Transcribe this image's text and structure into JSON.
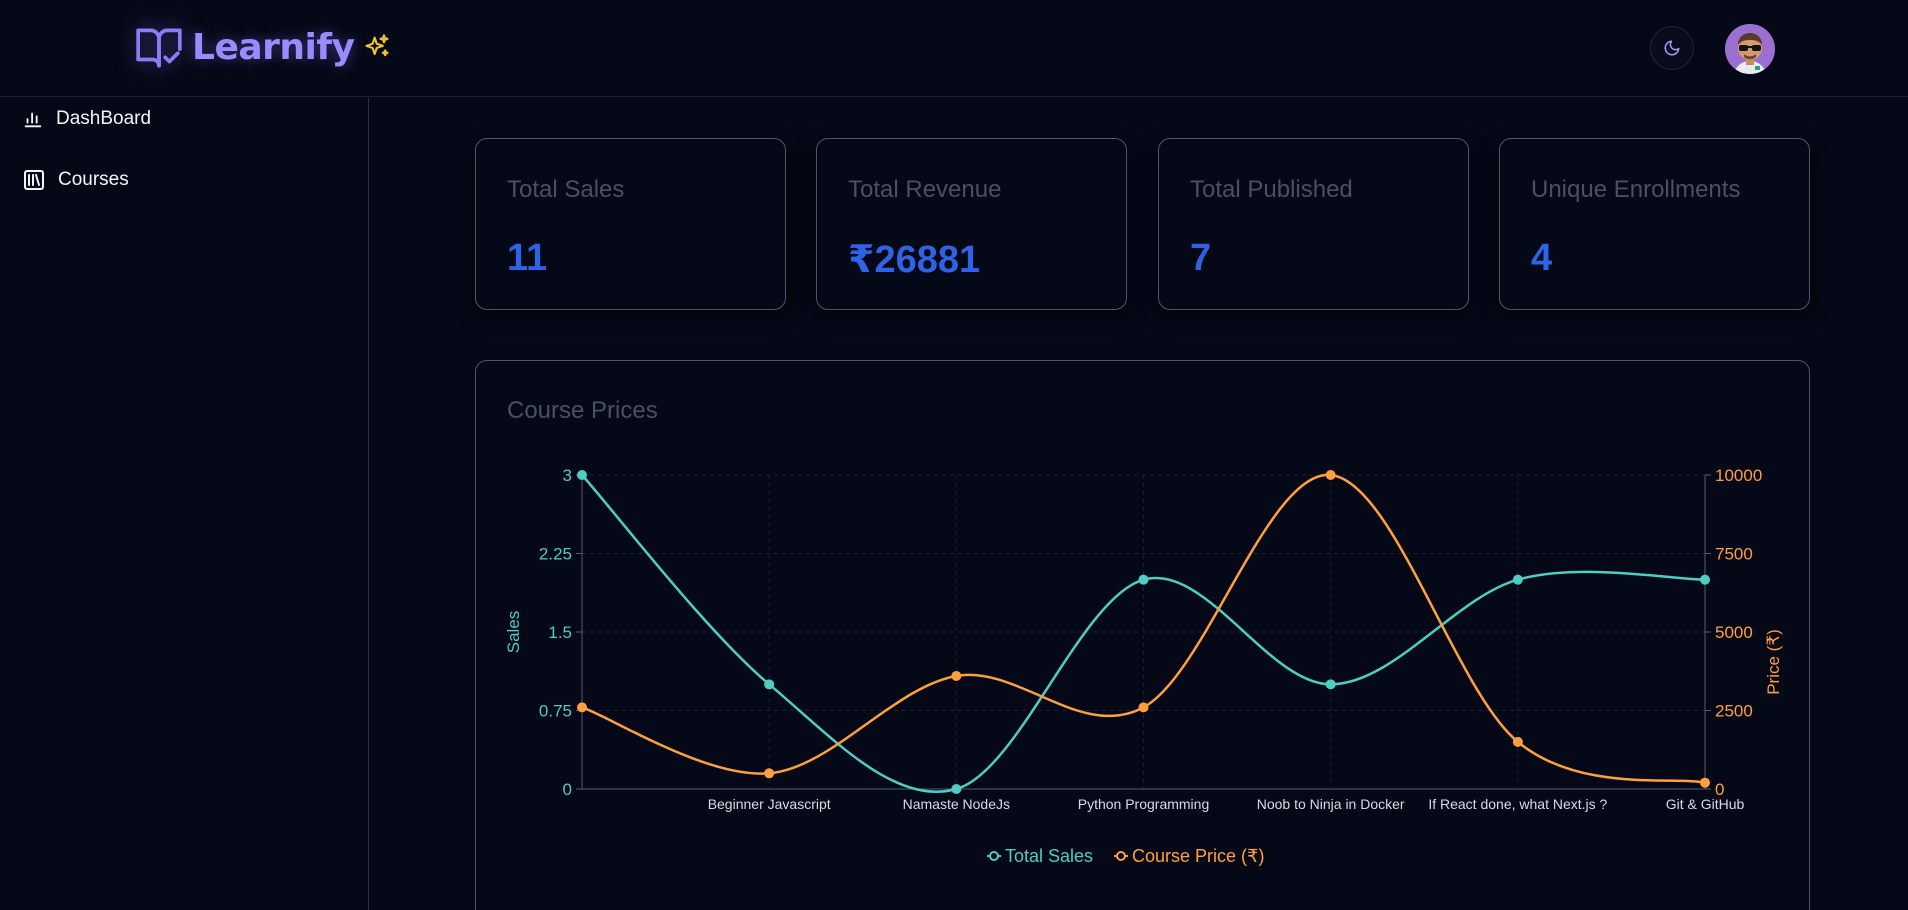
{
  "app": {
    "name": "Learnify"
  },
  "header": {
    "logo_icon": "book-check-icon",
    "sparkle_icon": "sparkles-icon",
    "theme_icon": "moon-icon",
    "avatar_icon": "avatar-memoji"
  },
  "sidebar": {
    "items": [
      {
        "label": "DashBoard",
        "icon": "bar-chart-icon"
      },
      {
        "label": "Courses",
        "icon": "library-icon"
      }
    ]
  },
  "stats": [
    {
      "title": "Total Sales",
      "value": "11"
    },
    {
      "title": "Total Revenue",
      "value": "₹26881"
    },
    {
      "title": "Total Published",
      "value": "7"
    },
    {
      "title": "Unique Enrollments",
      "value": "4"
    }
  ],
  "colors": {
    "accent": "#9a8cff",
    "value_blue": "#2f63e6",
    "sales_line": "#4ecdc4",
    "price_line": "#ff9f40"
  },
  "chart_data": {
    "type": "line",
    "title": "Course Prices",
    "categories": [
      "",
      "Beginner Javascript",
      "Namaste NodeJs",
      "Python Programming",
      "Noob to Ninja in Docker",
      "If React done, what Next.js ?",
      "Git & GitHub"
    ],
    "series": [
      {
        "name": "Total Sales",
        "axis": "left",
        "color": "#4ecdc4",
        "values": [
          3,
          1,
          0,
          2,
          1,
          2,
          2
        ]
      },
      {
        "name": "Course Price (₹)",
        "axis": "right",
        "color": "#ff9f40",
        "values": [
          2600,
          500,
          3600,
          2600,
          10000,
          1500,
          200
        ]
      }
    ],
    "ylabel": "Sales",
    "y2label": "Price (₹)",
    "ylim": [
      0,
      3
    ],
    "y2lim": [
      0,
      10000
    ],
    "yticks": [
      "0",
      "0.75",
      "1.5",
      "2.25",
      "3"
    ],
    "y2ticks": [
      "0",
      "2500",
      "5000",
      "7500",
      "10000"
    ],
    "grid": true,
    "legend": "bottom",
    "smooth": true
  }
}
